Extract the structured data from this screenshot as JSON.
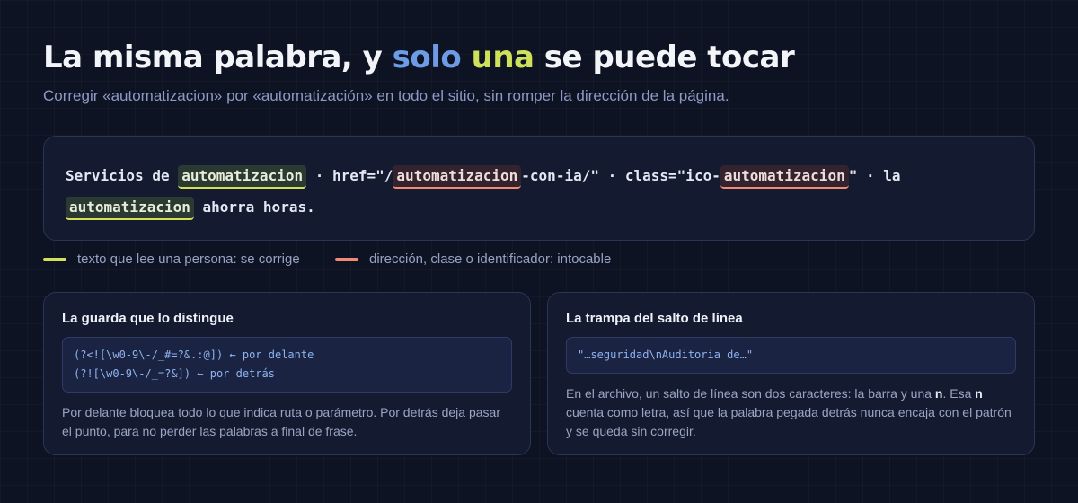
{
  "header": {
    "title_part1": "La misma palabra, y ",
    "title_hl1": "solo",
    "title_space": " ",
    "title_hl2": "una",
    "title_part2": " se puede tocar",
    "subtitle": "Corregir «automatizacion» por «automatización» en todo el sitio, sin romper la dirección de la página."
  },
  "code_sample": {
    "t1": "Servicios de ",
    "w1": "automatizacion",
    "t2": " · href=\"/",
    "w2": "automatizacion",
    "t3": "-con-ia/\" · class=\"ico-",
    "w3": "automatizacion",
    "t4": "\" · la",
    "w4": "automatizacion",
    "t5": " ahorra horas."
  },
  "legend": {
    "text_label": "texto que lee una persona: se corrige",
    "url_label": "dirección, clase o identificador: intocable",
    "text_color": "#d4e157",
    "url_color": "#f08a72"
  },
  "card_left": {
    "title": "La guarda que lo distingue",
    "code_line1": "(?<![\\w0-9\\-/_#=?&.:@]) ← por delante",
    "code_line2": "(?![\\w0-9\\-/_=?&]) ← por detrás",
    "text": "Por delante bloquea todo lo que indica ruta o parámetro. Por detrás deja pasar el punto, para no perder las palabras a final de frase."
  },
  "card_right": {
    "title": "La trampa del salto de línea",
    "code_line1": "\"…seguridad\\nAuditoria de…\"",
    "text_p1": "En el archivo, un salto de línea son dos caracteres: la barra y una ",
    "text_b1": "n",
    "text_p2": ". Esa ",
    "text_b2": "n",
    "text_p3": " cuenta como letra, así que la palabra pegada detrás nunca encaja con el patrón y se queda sin corregir."
  }
}
